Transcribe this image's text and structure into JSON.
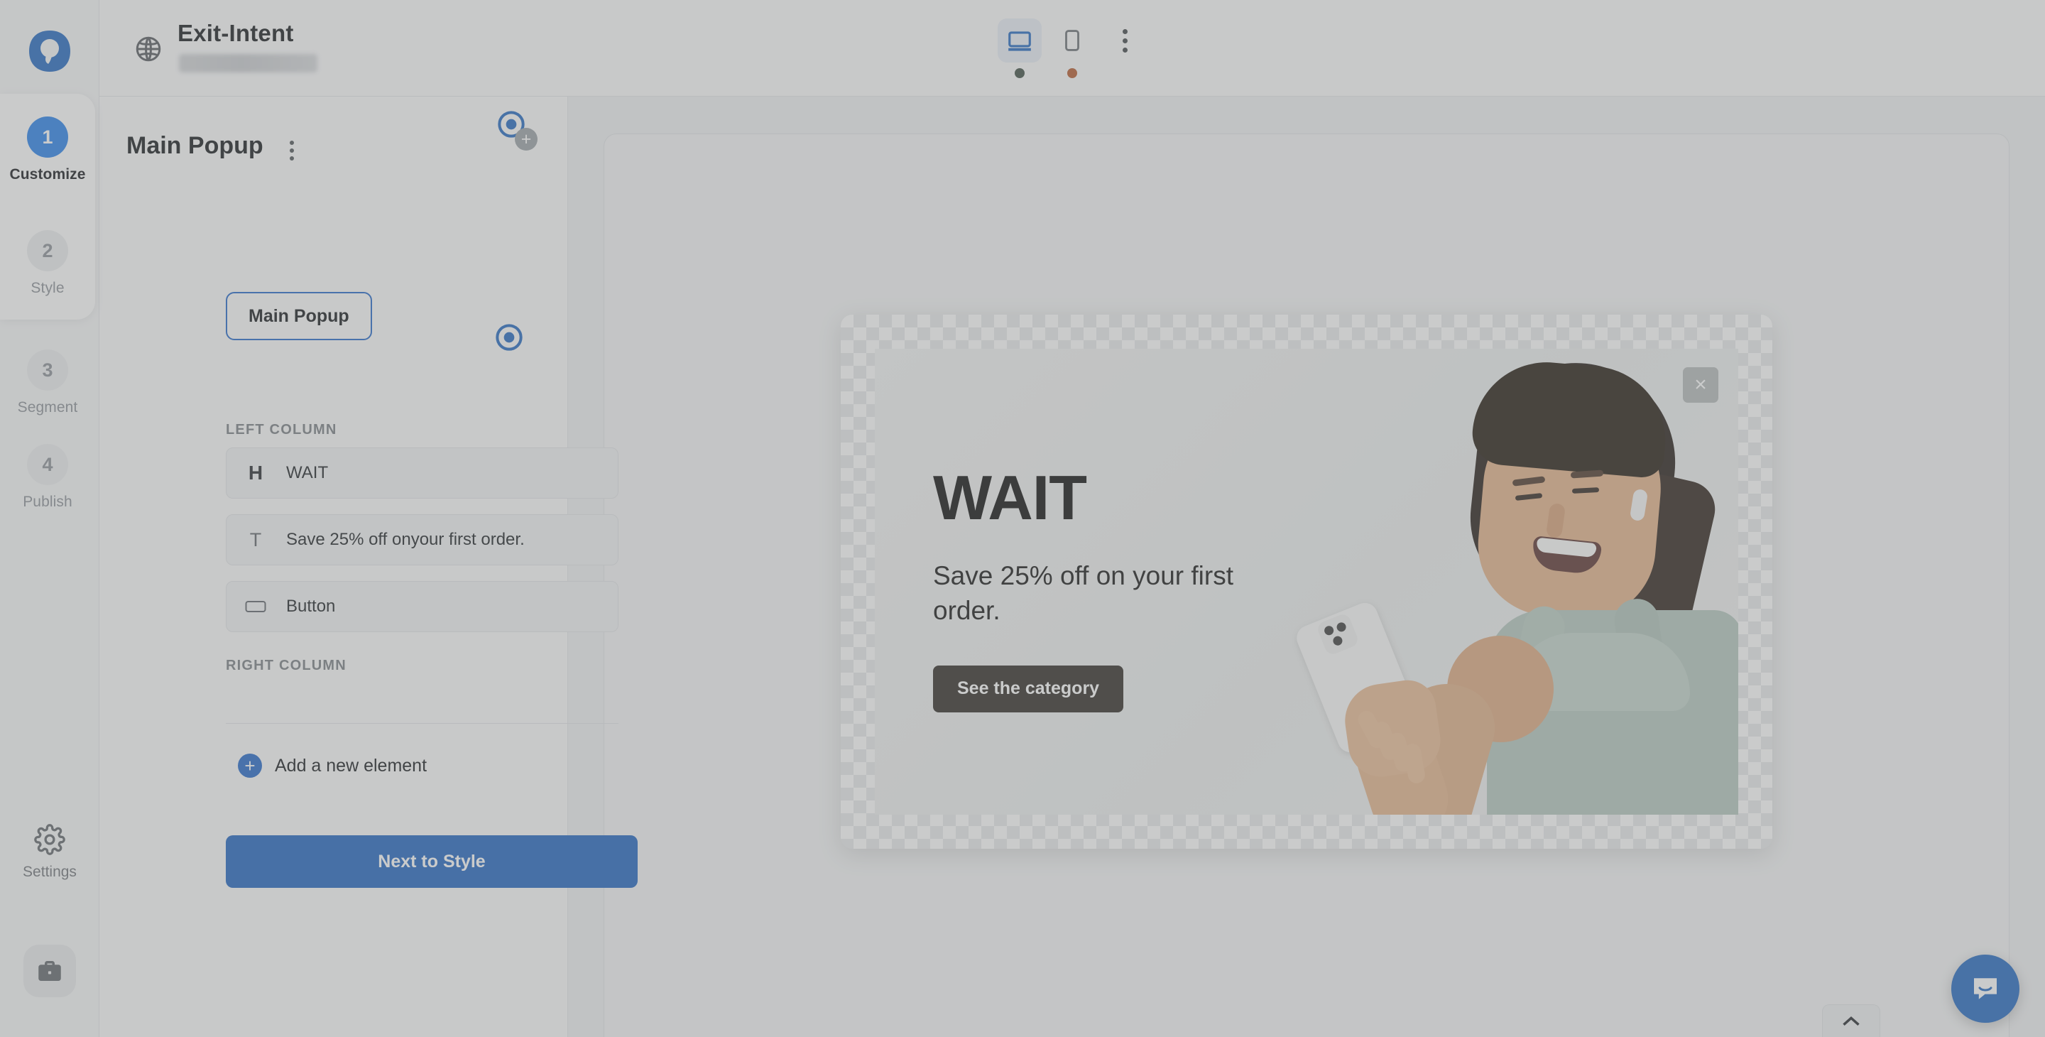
{
  "brand": {
    "logo_name": "optimonk-logo",
    "accent": "#2680eb",
    "primary_button": "#1e62bf"
  },
  "rail": {
    "steps": [
      {
        "number": "1",
        "label": "Customize",
        "state": "active"
      },
      {
        "number": "2",
        "label": "Style",
        "state": "idle"
      },
      {
        "number": "3",
        "label": "Segment",
        "state": "idle"
      },
      {
        "number": "4",
        "label": "Publish",
        "state": "idle"
      }
    ],
    "settings_label": "Settings",
    "briefcase_name": "briefcase-button"
  },
  "topbar": {
    "campaign_title": "Exit-Intent",
    "domain_redacted": "",
    "devices": [
      {
        "name": "desktop",
        "active": true,
        "dot_color": "#3d4d43"
      },
      {
        "name": "mobile",
        "active": false,
        "dot_color": "#b5592c"
      }
    ],
    "more_menu": "more-options"
  },
  "panel": {
    "title": "Main Popup",
    "tab_label": "Main Popup",
    "left_column_label": "LEFT COLUMN",
    "right_column_label": "RIGHT COLUMN",
    "elements": [
      {
        "icon": "heading-icon",
        "glyph": "H",
        "label": "WAIT"
      },
      {
        "icon": "text-icon",
        "glyph": "T",
        "label": "Save 25% off onyour first order."
      },
      {
        "icon": "button-icon",
        "glyph": "",
        "label": "Button"
      }
    ],
    "add_element_label": "Add a new element",
    "next_button_label": "Next to Style"
  },
  "popup_preview": {
    "heading": "WAIT",
    "subtext": "Save 25% off on your first order.",
    "cta_label": "See the category",
    "close_label": "×",
    "cta_background": "#2d2823",
    "image_alt": "smiling-woman-with-phone"
  },
  "widgets": {
    "expand_tab": "expand-panel-chevron",
    "chat_launcher": "intercom-chat-launcher"
  }
}
